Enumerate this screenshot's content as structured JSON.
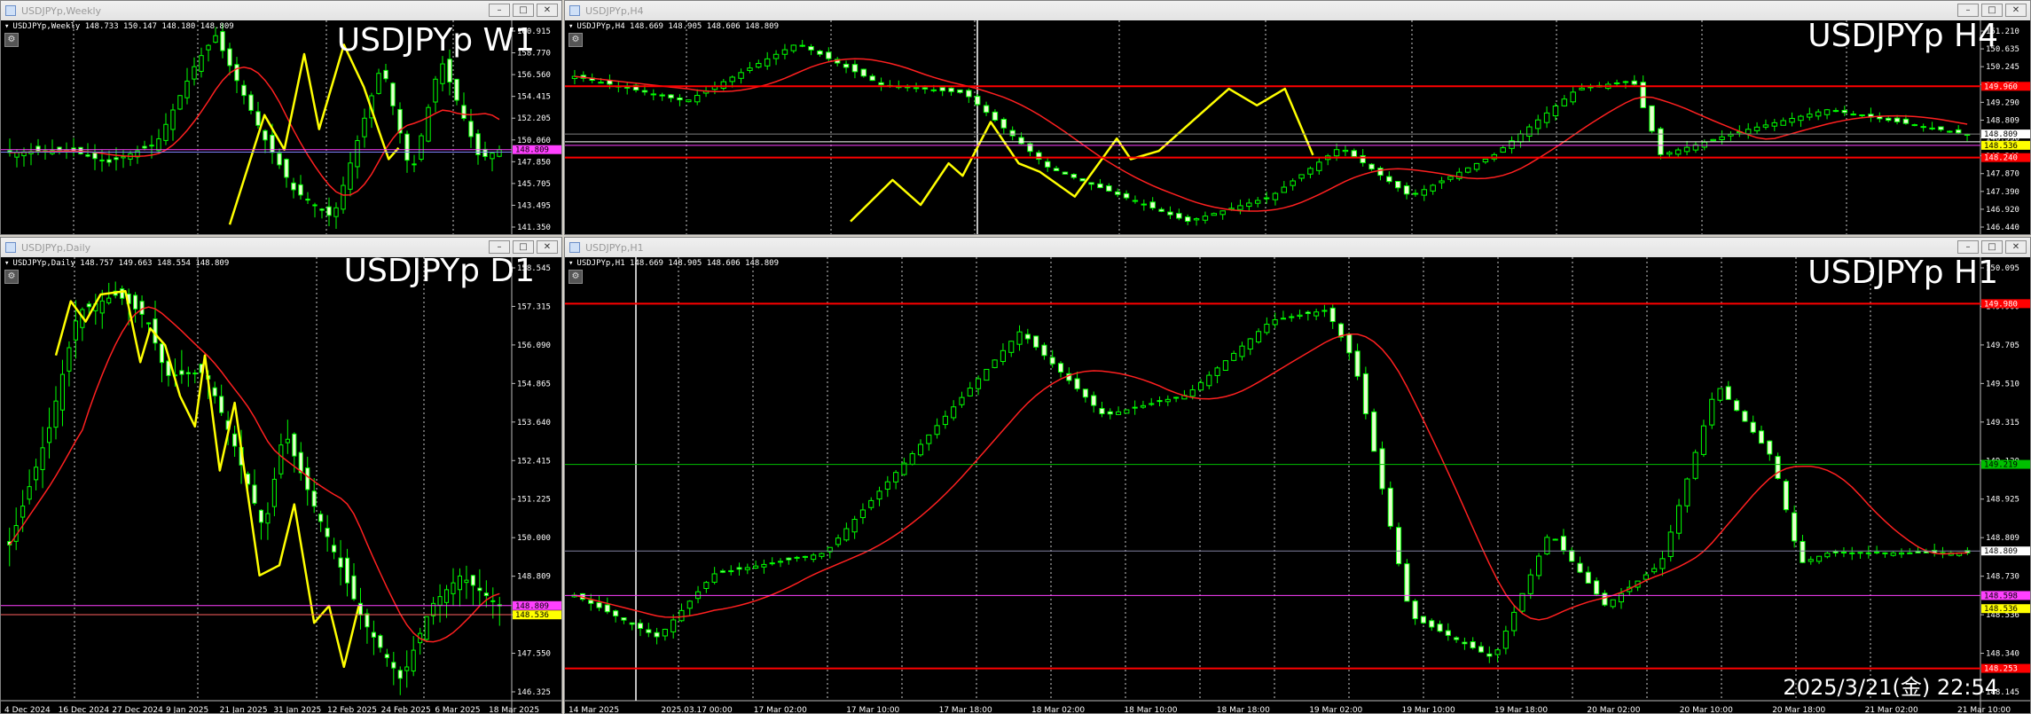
{
  "windows": [
    {
      "id": "w1",
      "title": "USDJPYp,Weekly",
      "ohlc_info": "USDJPYp,Weekly  148.733 150.147 148.180 148.809",
      "label": "USDJPYp W1",
      "price_ticks": [
        "160.915",
        "158.770",
        "156.560",
        "154.415",
        "152.205",
        "150.060",
        "147.850",
        "145.705",
        "143.495",
        "141.350"
      ],
      "time_ticks": [],
      "price_range": [
        139.6,
        162.6
      ],
      "line_colors": {
        "ma": "#ff2020",
        "zigzag": "#ffff00",
        "hline_a": "#ff40ff",
        "hline_b": "#8080ff"
      },
      "markers": [
        {
          "text": "148.809",
          "bg": "#ff40ff",
          "fg": "#000"
        }
      ]
    },
    {
      "id": "h4",
      "title": "USDJPYp,H4",
      "ohlc_info": "USDJPYp,H4  148.669 148.905 148.606 148.809",
      "label": "USDJPYp H4",
      "price_ticks": [
        "151.210",
        "150.635",
        "150.245",
        "149.770",
        "149.290",
        "148.809",
        "148.536",
        "148.240",
        "147.870",
        "147.390",
        "146.920",
        "146.440"
      ],
      "time_ticks": [],
      "price_range": [
        146.35,
        151.55
      ],
      "line_colors": {
        "ma": "#ff2020",
        "zigzag": "#ffff00",
        "hline_red": "#ff0000"
      },
      "markers": [
        {
          "text": "149.960",
          "bg": "#ff0000",
          "fg": "#fff"
        },
        {
          "text": "148.809",
          "bg": "#ffffff",
          "fg": "#000"
        },
        {
          "text": "148.536",
          "bg": "#ffff00",
          "fg": "#000"
        },
        {
          "text": "148.240",
          "bg": "#ff0000",
          "fg": "#fff"
        }
      ]
    },
    {
      "id": "d1",
      "title": "USDJPYp,Daily",
      "ohlc_info": "USDJPYp,Daily  148.757 149.663 148.554 148.809",
      "label": "USDJPYp D1",
      "price_ticks": [
        "158.545",
        "157.315",
        "156.090",
        "154.865",
        "153.640",
        "152.415",
        "151.225",
        "150.000",
        "148.809",
        "148.536",
        "147.550",
        "146.325"
      ],
      "time_ticks": [
        "4 Dec 2024",
        "16 Dec 2024",
        "27 Dec 2024",
        "9 Jan 2025",
        "21 Jan 2025",
        "31 Jan 2025",
        "12 Feb 2025",
        "24 Feb 2025",
        "6 Mar 2025",
        "18 Mar 2025"
      ],
      "price_range": [
        146.0,
        159.1
      ],
      "line_colors": {
        "ma": "#ff2020",
        "zigzag": "#ffff00"
      },
      "markers": [
        {
          "text": "148.809",
          "bg": "#ff40ff",
          "fg": "#000"
        },
        {
          "text": "148.536",
          "bg": "#ffff00",
          "fg": "#000"
        }
      ]
    },
    {
      "id": "h1",
      "title": "USDJPYp,H1",
      "ohlc_info": "USDJPYp,H1  148.669 148.905 148.606 148.809",
      "label": "USDJPYp H1",
      "price_ticks": [
        "150.095",
        "149.900",
        "149.705",
        "149.510",
        "149.315",
        "149.120",
        "148.925",
        "148.809",
        "148.730",
        "148.536",
        "148.340",
        "148.145"
      ],
      "time_ticks": [
        "14 Mar 2025",
        "2025.03.17 00:00",
        "17 Mar 02:00",
        "17 Mar 10:00",
        "17 Mar 18:00",
        "18 Mar 02:00",
        "18 Mar 10:00",
        "18 Mar 18:00",
        "19 Mar 02:00",
        "19 Mar 10:00",
        "19 Mar 18:00",
        "20 Mar 02:00",
        "20 Mar 10:00",
        "20 Mar 18:00",
        "21 Mar 02:00",
        "21 Mar 10:00"
      ],
      "price_range": [
        148.1,
        150.2
      ],
      "line_colors": {
        "ma": "#ff2020",
        "hline_red": "#ff0000",
        "hline_green": "#00c000"
      },
      "markers": [
        {
          "text": "149.980",
          "bg": "#ff0000",
          "fg": "#fff"
        },
        {
          "text": "149.219",
          "bg": "#00c000",
          "fg": "#000"
        },
        {
          "text": "148.809",
          "bg": "#ffffff",
          "fg": "#000"
        },
        {
          "text": "148.598",
          "bg": "#ff40ff",
          "fg": "#000"
        },
        {
          "text": "148.536",
          "bg": "#ffff00",
          "fg": "#000"
        },
        {
          "text": "148.253",
          "bg": "#ff0000",
          "fg": "#fff"
        }
      ],
      "datestamp": "2025/3/21(金) 22:54"
    }
  ],
  "window_buttons": {
    "minimize": "–",
    "maximize": "□",
    "close": "✕"
  },
  "colors": {
    "candle": "#00ff00",
    "bg": "#000000",
    "text": "#ffffff"
  }
}
